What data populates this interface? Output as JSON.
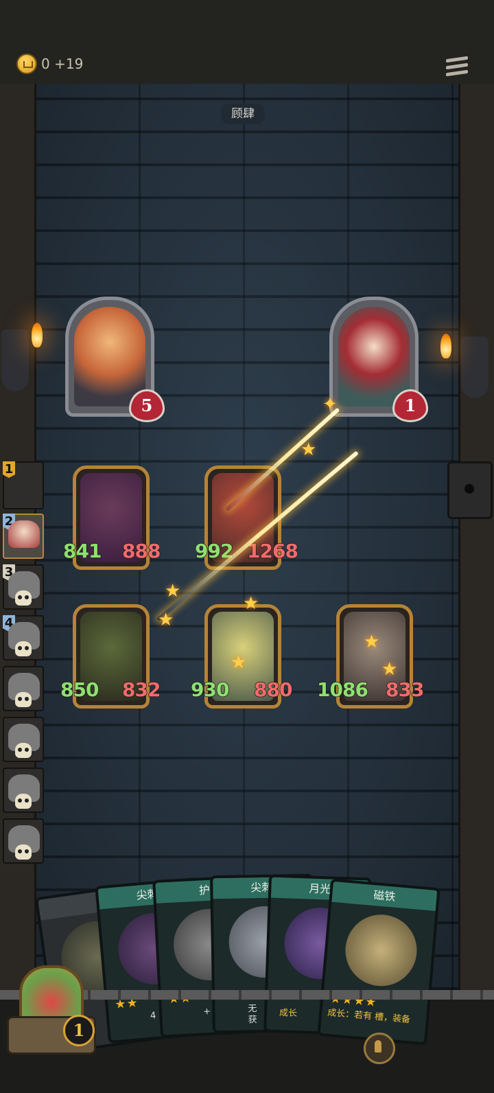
{
  "header": {
    "gold": "0 +19"
  },
  "board": {
    "title": "顾肆"
  },
  "player": {
    "hp": "5"
  },
  "enemy": {
    "hp": "1"
  },
  "units": [
    {
      "atk": "841",
      "hp": "888"
    },
    {
      "atk": "992",
      "hp": "1268"
    },
    {
      "atk": "850",
      "hp": "832"
    },
    {
      "atk": "930",
      "hp": "880"
    },
    {
      "atk": "1086",
      "hp": "833"
    }
  ],
  "queue": [
    {
      "num": "1"
    },
    {
      "num": "2"
    },
    {
      "num": "3"
    },
    {
      "num": "4"
    }
  ],
  "cards": [
    {
      "title": "尖刺"
    },
    {
      "title": "护"
    },
    {
      "title": "尖刺"
    },
    {
      "title": "月光"
    },
    {
      "title": "磁铁",
      "desc": "成长：若有 槽，装备"
    }
  ],
  "card_fragments": {
    "c2": "4",
    "c3": "+",
    "c4a": "无",
    "c4b": "获",
    "c5": "成长"
  },
  "hero": {
    "count": "1"
  }
}
